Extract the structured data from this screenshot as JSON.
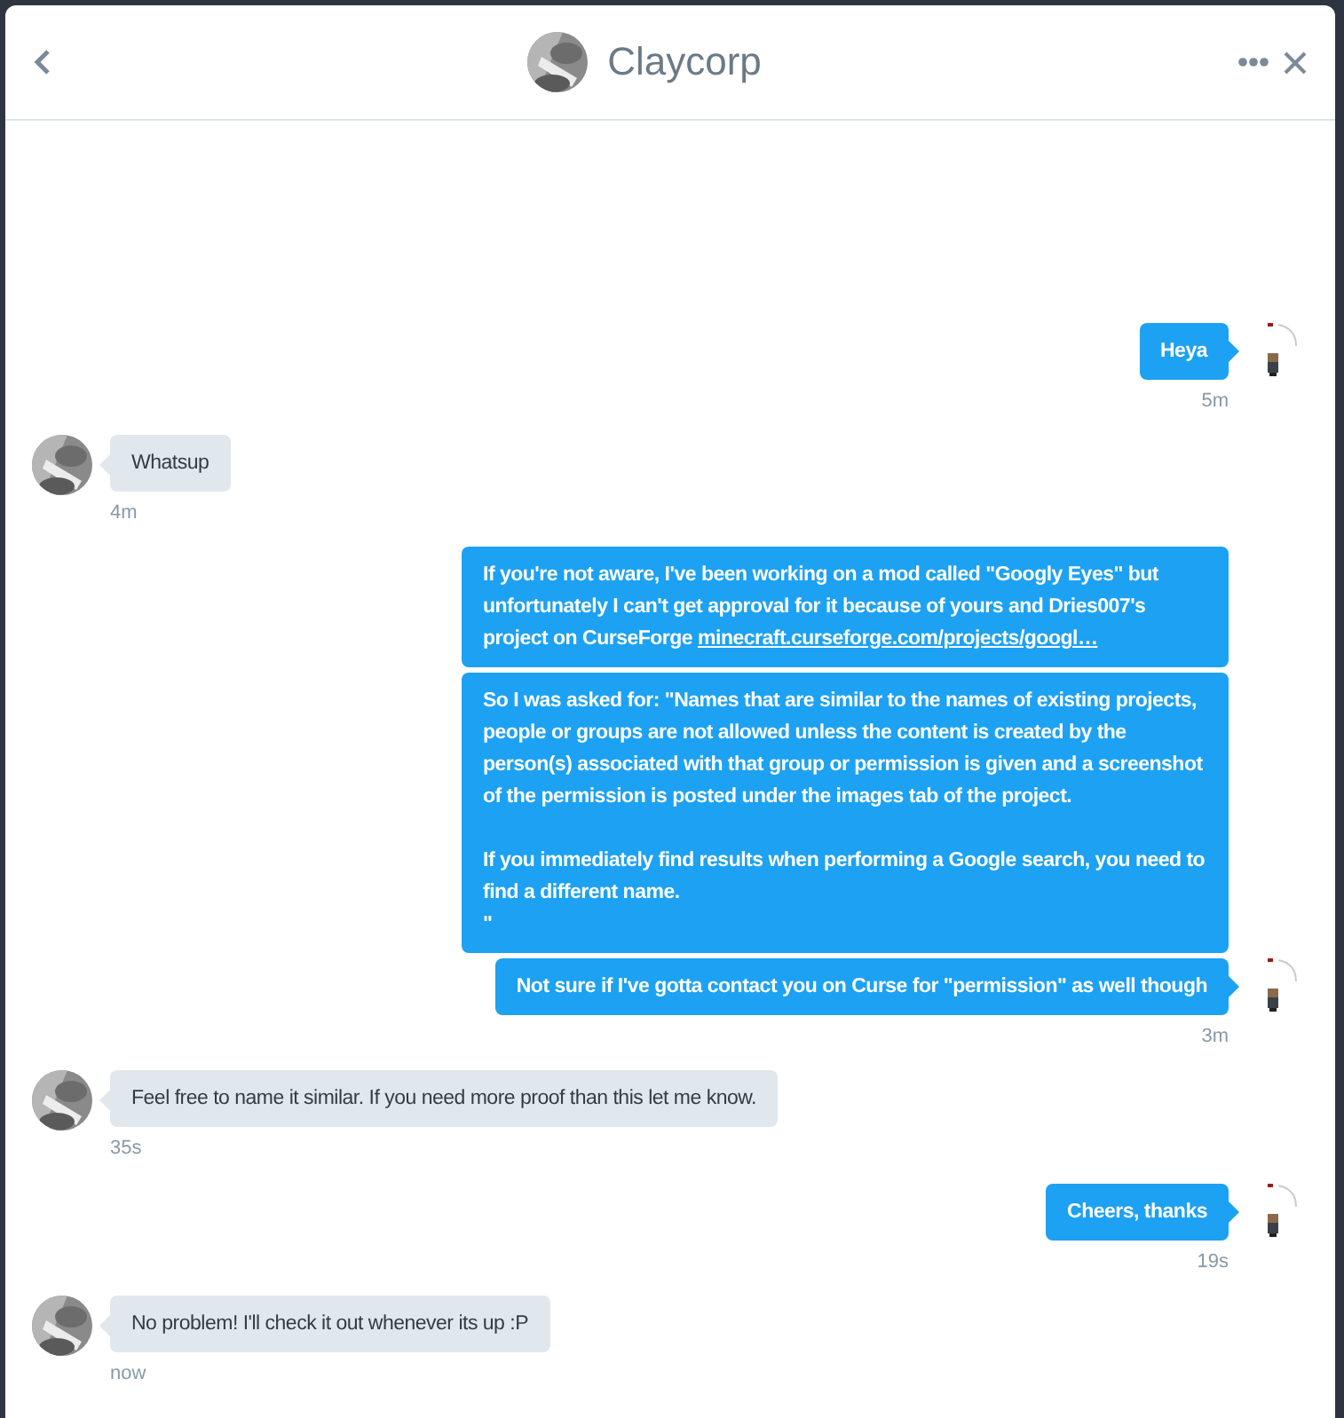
{
  "header": {
    "title": "Claycorp"
  },
  "messages": [
    {
      "kind": "sent",
      "time": "5m",
      "bubbles": [
        {
          "text": "Heya"
        }
      ]
    },
    {
      "kind": "received",
      "time": "4m",
      "bubbles": [
        {
          "text": "Whatsup"
        }
      ]
    },
    {
      "kind": "sent",
      "time": "3m",
      "bubbles": [
        {
          "text": "If you're not aware, I've been working on a mod called \"Googly Eyes\" but unfortunately I can't get approval for it because of yours and Dries007's project on CurseForge ",
          "link": "minecraft.curseforge.com/projects/googl…"
        },
        {
          "text": "So I was asked for: \"Names that are similar to the names of existing projects, people or groups are not allowed unless the content is created by the person(s) associated with that group or permission is given and a screenshot of the permission is posted under the images tab of the project.\n\nIf you immediately find results when performing a Google search, you need to find a different name.\n\""
        },
        {
          "text": "Not sure if I've gotta contact you on Curse for \"permission\" as well though"
        }
      ]
    },
    {
      "kind": "received",
      "time": "35s",
      "bubbles": [
        {
          "text": "Feel free to name it similar. If you need more proof than this let me know."
        }
      ]
    },
    {
      "kind": "sent",
      "time": "19s",
      "bubbles": [
        {
          "text": "Cheers, thanks"
        }
      ]
    },
    {
      "kind": "received",
      "time": "now",
      "bubbles": [
        {
          "text": "No problem! I'll check it out whenever its up :P"
        }
      ]
    }
  ]
}
